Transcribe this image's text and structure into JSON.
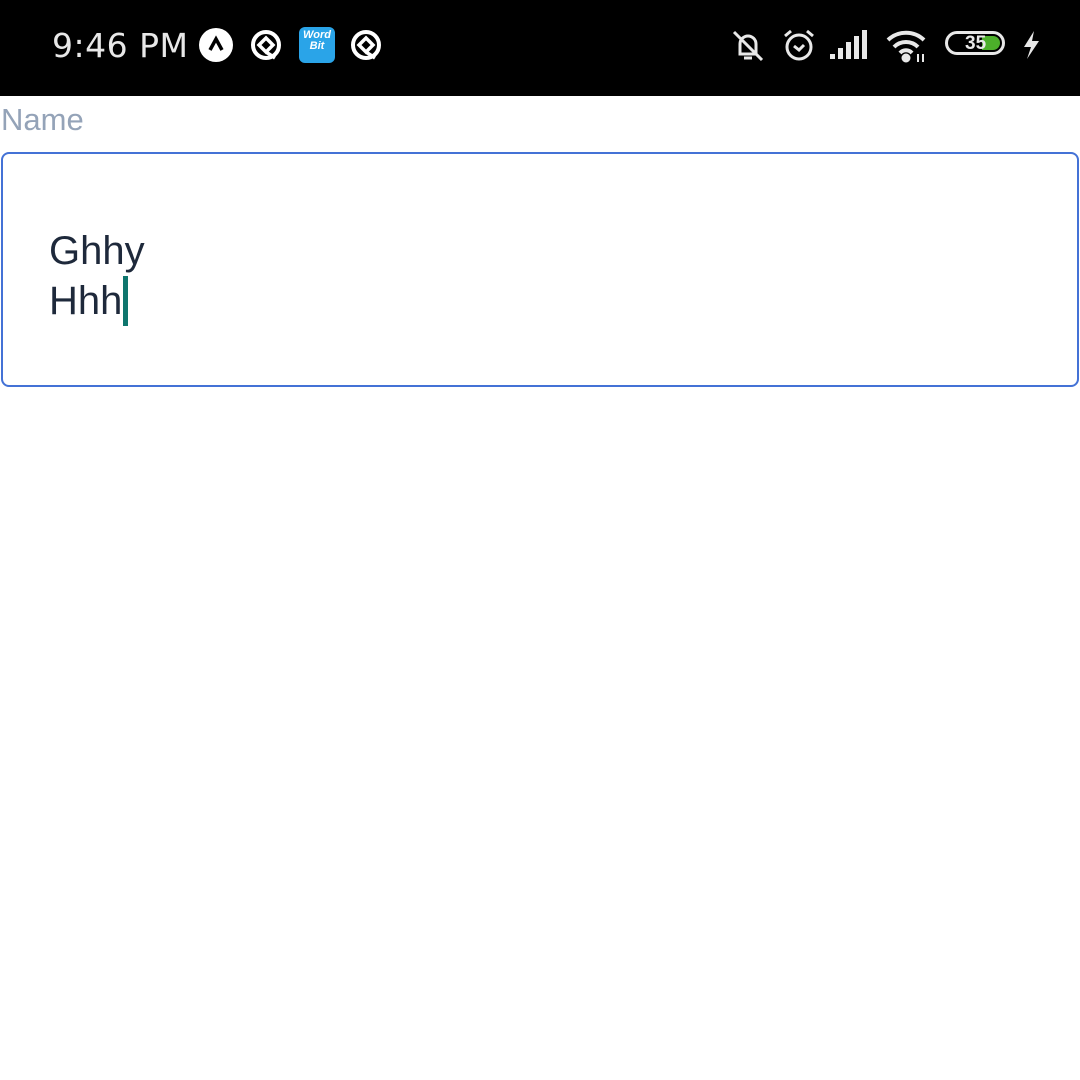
{
  "status_bar": {
    "time": "9:46 PM",
    "notification_icons": [
      "up-arrow-app-icon",
      "q-app-icon",
      "wordbit-app-icon",
      "q-app-icon"
    ],
    "wordbit_text": [
      "Word",
      "Bit"
    ],
    "battery_level": 35,
    "battery_label": "35",
    "battery_fill_color": "#4caf2a",
    "charging": true
  },
  "form": {
    "label": "Name",
    "value_lines": [
      "Ghhy",
      "Hhh"
    ],
    "border_color": "#4472d6",
    "caret_color": "#0f766e"
  }
}
